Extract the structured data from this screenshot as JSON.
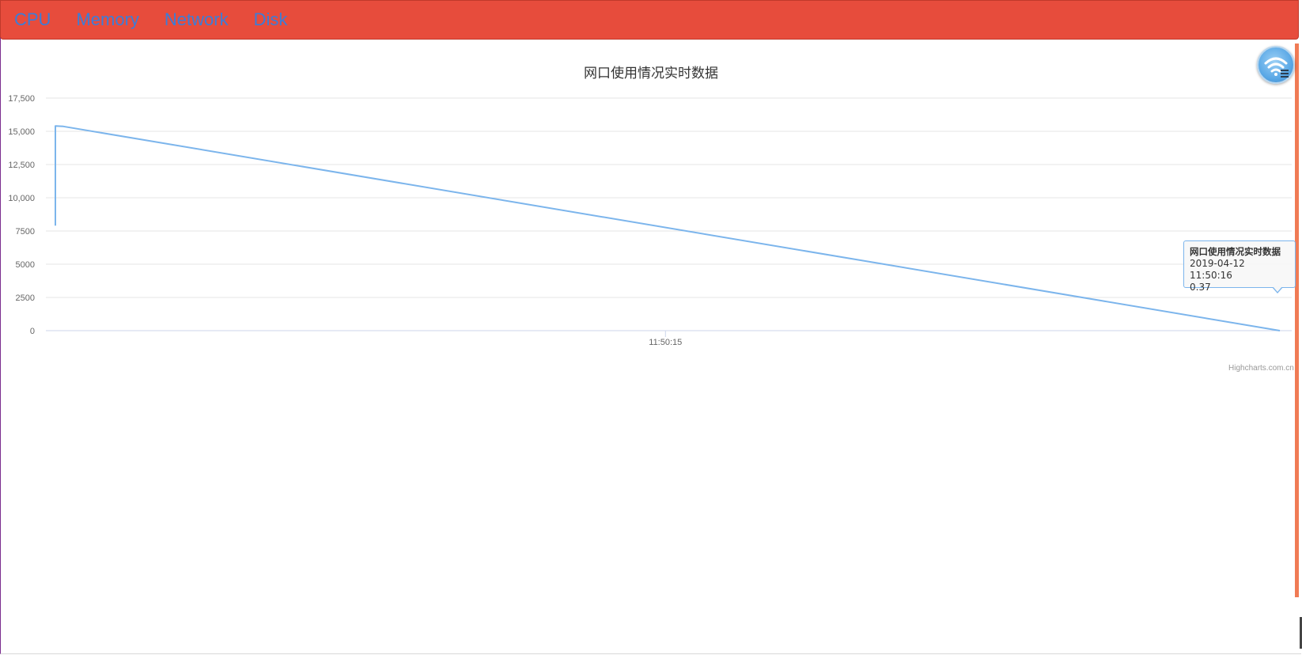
{
  "nav": {
    "items": [
      {
        "label": "CPU"
      },
      {
        "label": "Memory"
      },
      {
        "label": "Network"
      },
      {
        "label": "Disk"
      }
    ]
  },
  "floating_button": {
    "icon": "wifi-icon"
  },
  "chart_data": {
    "type": "line",
    "title": "网口使用情况实时数据",
    "xlabel": "",
    "ylabel": "",
    "ylim": [
      0,
      17500
    ],
    "y_ticks": [
      "17,500",
      "15,000",
      "12,500",
      "10,000",
      "7500",
      "5000",
      "2500",
      "0"
    ],
    "y_tick_values": [
      17500,
      15000,
      12500,
      10000,
      7500,
      5000,
      2500,
      0
    ],
    "x_ticks": [
      "11:50:15"
    ],
    "x_type": "datetime",
    "x_range": [
      "2019-04-12 11:50:14.007",
      "2019-04-12 11:50:16"
    ],
    "series": [
      {
        "color": "#7cb5ec",
        "points": [
          {
            "x": "2019-04-12 11:50:14.007",
            "y": 7900
          },
          {
            "x": "2019-04-12 11:50:14.007",
            "y": 15400
          },
          {
            "x": "2019-04-12 11:50:14.020",
            "y": 15370
          },
          {
            "x": "2019-04-12 11:50:16",
            "y": 0.37
          }
        ]
      }
    ],
    "grid": true,
    "credits": "Highcharts.com.cn",
    "tooltip": {
      "title": "网口使用情况实时数据",
      "time": "2019-04-12 11:50:16",
      "value": "0.37"
    }
  }
}
